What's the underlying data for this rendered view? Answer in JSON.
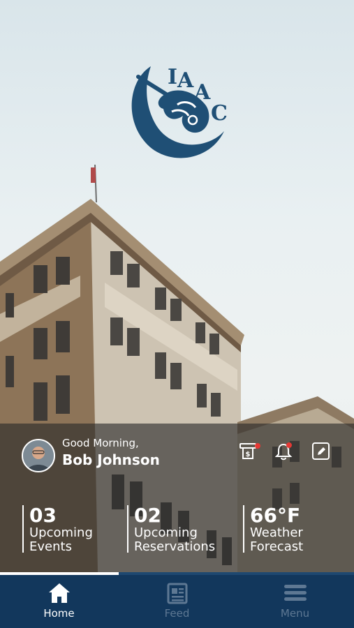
{
  "header": {
    "logo_text": "IAAC"
  },
  "greeting": {
    "salutation": "Good Morning,",
    "user_name": "Bob Johnson"
  },
  "stats": [
    {
      "number": "03",
      "line1": "Upcoming",
      "line2": "Events"
    },
    {
      "number": "02",
      "line1": "Upcoming",
      "line2": "Reservations"
    },
    {
      "number": "66°F",
      "line1": "Weather",
      "line2": "Forecast"
    }
  ],
  "icons": {
    "billing": "billing-icon",
    "notifications": "bell-icon",
    "edit": "edit-icon"
  },
  "tabs": [
    {
      "label": "Home",
      "icon": "home-icon",
      "active": true
    },
    {
      "label": "Feed",
      "icon": "feed-icon",
      "active": false
    },
    {
      "label": "Menu",
      "icon": "menu-icon",
      "active": false
    }
  ],
  "colors": {
    "brand": "#12375c",
    "logo": "#1f4f75",
    "badge": "#e53935"
  }
}
